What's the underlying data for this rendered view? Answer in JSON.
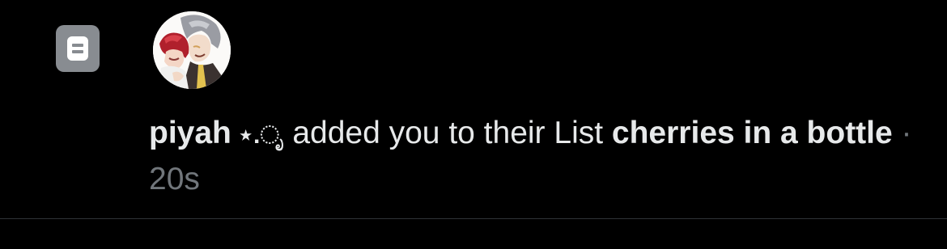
{
  "notification": {
    "icon": "list-icon",
    "avatar": "user-avatar",
    "user_name": "piyah",
    "user_name_emoji": " ⋆.ೃ",
    "action_text": " added you to their List ",
    "list_name": "cherries in a bottle",
    "separator": " · ",
    "timestamp": "20s"
  },
  "colors": {
    "background": "#000000",
    "text_primary": "#e7e9ea",
    "text_secondary": "#71767b",
    "icon_bg": "#888c91",
    "divider": "#2f3336"
  }
}
